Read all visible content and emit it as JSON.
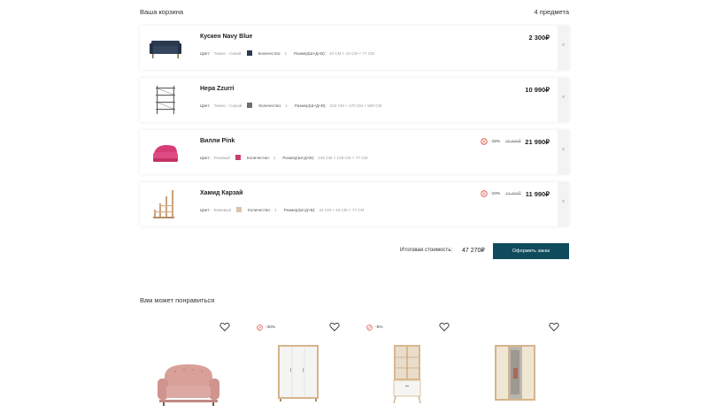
{
  "cart": {
    "title": "Ваша корзина",
    "count": "4 предмета",
    "items": [
      {
        "name": "Кускен Navy Blue",
        "color_label": "Цвет:",
        "color_value": "Темно - Синий",
        "swatch": "#2b3a4f",
        "qty_label": "Количество:",
        "qty_value": "1",
        "size_label": "Размер(Ш×Д×В):",
        "size_value": "43 СМ × 43 СМ × 77 СМ",
        "price": "2 300₽",
        "thumb": "sofa-navy-icon"
      },
      {
        "name": "Нера Zzurri",
        "color_label": "Цвет:",
        "color_value": "Темно - Серый",
        "swatch": "#6e6e6e",
        "qty_label": "Количество:",
        "qty_value": "1",
        "size_label": "Размер(Ш×Д×В):",
        "size_value": "234 СМ × 170 СМ × 500 СМ",
        "price": "10 990₽",
        "thumb": "shelf-icon"
      },
      {
        "name": "Вилли Pink",
        "color_label": "Цвет:",
        "color_value": "Розовый",
        "swatch": "#c8406a",
        "qty_label": "Количество:",
        "qty_value": "1",
        "size_label": "Размер(Ш×Д×В):",
        "size_value": "145 СМ × 128 СМ × 77 СМ",
        "discount": "-15%",
        "old_price": "25 990₽",
        "price": "21 990₽",
        "thumb": "pink-chair-icon"
      },
      {
        "name": "Хамид Карзай",
        "color_label": "Цвет:",
        "color_value": "Бежевый",
        "swatch": "#d8c3ad",
        "qty_label": "Количество:",
        "qty_value": "1",
        "size_label": "Размер(Ш×Д×В):",
        "size_value": "43 СМ × 43 СМ × 77 СМ",
        "discount": "-10%",
        "old_price": "13 450₽",
        "price": "11 990₽",
        "thumb": "ladder-shelf-icon"
      }
    ],
    "total_label": "Итоговая стоимость:",
    "total_value": "47 270₽",
    "order_button": "Оформить заказ"
  },
  "recommendations": {
    "title": "Вам может понравиться",
    "cards": [
      {
        "badge": "",
        "image": "pink-sofa-icon"
      },
      {
        "badge": "-30%",
        "image": "white-wardrobe-icon"
      },
      {
        "badge": "-5%",
        "image": "display-cabinet-icon"
      },
      {
        "badge": "",
        "image": "mirror-wardrobe-icon"
      }
    ]
  },
  "colors": {
    "accent": "#0e4b5c",
    "discount_icon": "#e0463a"
  }
}
